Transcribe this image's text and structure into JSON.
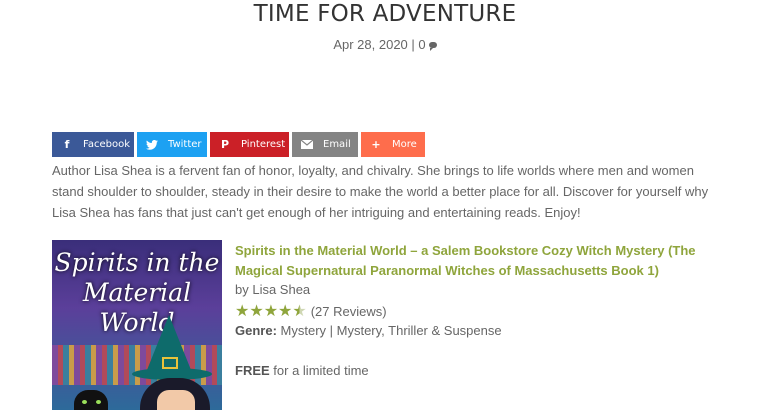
{
  "post": {
    "title": "TIME FOR ADVENTURE",
    "date": "Apr 28, 2020",
    "separator": "|",
    "comment_count": "0"
  },
  "share": {
    "facebook": "Facebook",
    "twitter": "Twitter",
    "pinterest": "Pinterest",
    "email": "Email",
    "more": "More"
  },
  "intro": "Author Lisa Shea is a fervent fan of honor, loyalty, and chivalry. She brings to life worlds where men and women stand shoulder to shoulder, steady in their desire to make the world a better place for all. Discover for yourself why Lisa Shea has fans that just can't get enough of her intriguing and entertaining reads. Enjoy!",
  "book": {
    "cover_text": "Spirits in the Material World",
    "title": "Spirits in the Material World – a Salem Bookstore Cozy Witch Mystery (The Magical Supernatural Paranormal Witches of Massachusetts Book 1)",
    "author": "by Lisa Shea",
    "rating": 4.5,
    "reviews": "(27 Reviews)",
    "genre_label": "Genre:",
    "genre_value": "Mystery | Mystery, Thriller & Suspense",
    "price_label": "FREE",
    "price_note": "for a limited time"
  }
}
